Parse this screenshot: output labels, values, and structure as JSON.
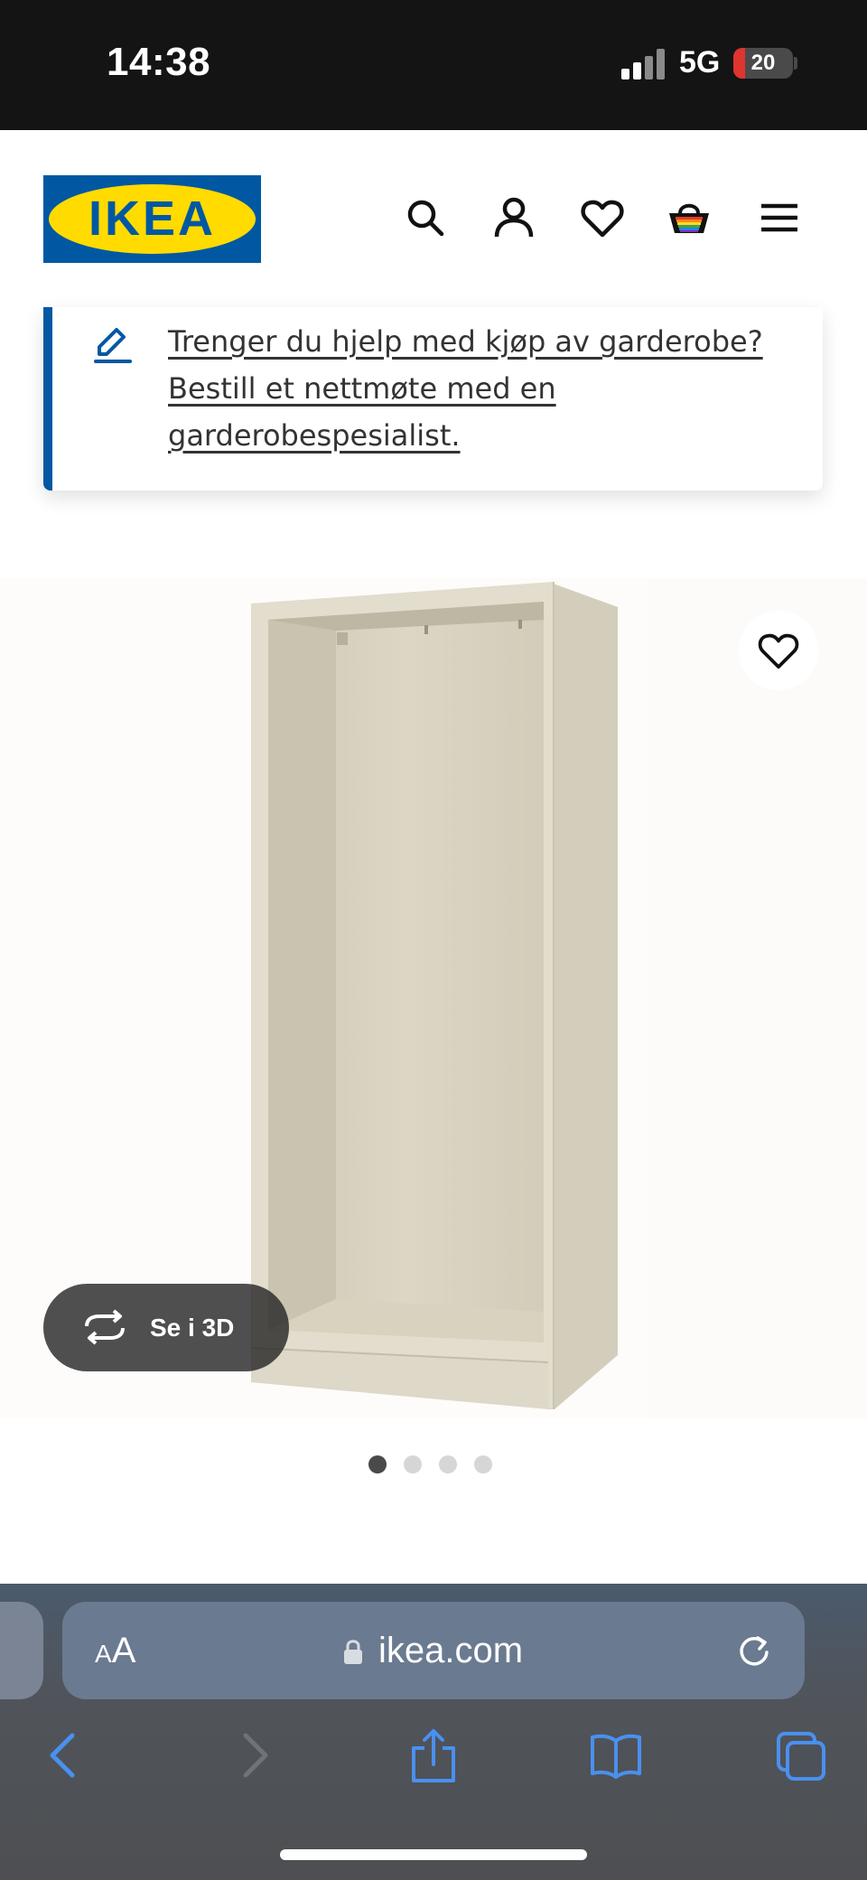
{
  "status_bar": {
    "time": "14:38",
    "network": "5G",
    "battery_level": "20",
    "battery_fraction": 0.2
  },
  "header": {
    "logo_text": "IKEA",
    "icons": [
      "search-icon",
      "account-icon",
      "heart-icon",
      "shopping-bag-icon",
      "menu-icon"
    ]
  },
  "info_card": {
    "icon": "pencil-icon",
    "link_text": "Trenger du hjelp med kjøp av garderobe? Bestill et nettmøte med en garderobespesialist."
  },
  "product": {
    "view_3d_label": "Se i 3D",
    "carousel": {
      "total": 4,
      "active_index": 0
    }
  },
  "browser": {
    "text_size_label_small": "A",
    "text_size_label_large": "A",
    "url": "ikea.com",
    "toolbar_icons": [
      "back-icon",
      "forward-icon",
      "share-icon",
      "bookmarks-icon",
      "tabs-icon"
    ]
  },
  "colors": {
    "brand_blue": "#0058a3",
    "brand_yellow": "#ffdb00",
    "status_bar_bg": "#141414",
    "battery_red": "#e0342f",
    "safari_accent": "#3b82f6"
  }
}
